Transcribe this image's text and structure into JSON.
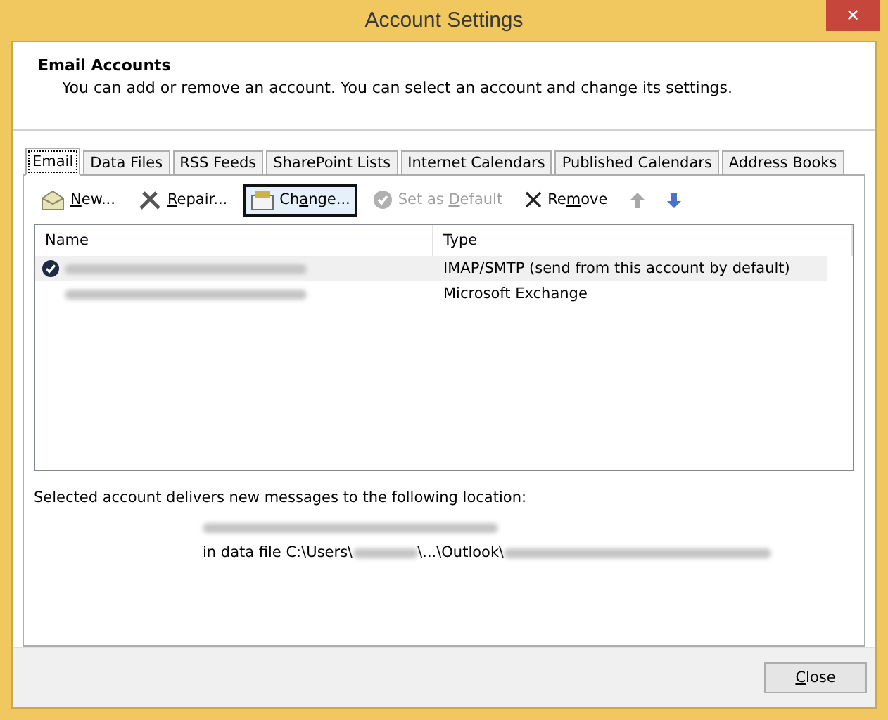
{
  "window": {
    "title": "Account Settings",
    "close": "✕"
  },
  "header": {
    "title": "Email Accounts",
    "description": "You can add or remove an account. You can select an account and change its settings."
  },
  "tabs": [
    {
      "label": "Email",
      "selected": true
    },
    {
      "label": "Data Files",
      "selected": false
    },
    {
      "label": "RSS Feeds",
      "selected": false
    },
    {
      "label": "SharePoint Lists",
      "selected": false
    },
    {
      "label": "Internet Calendars",
      "selected": false
    },
    {
      "label": "Published Calendars",
      "selected": false
    },
    {
      "label": "Address Books",
      "selected": false
    }
  ],
  "toolbar": [
    {
      "kind": "new",
      "key": "N",
      "after": "ew...",
      "disabled": false,
      "focused": false
    },
    {
      "kind": "repair",
      "key": "R",
      "after": "epair...",
      "disabled": false,
      "focused": false
    },
    {
      "kind": "change",
      "before": "Ch",
      "key": "a",
      "after": "nge...",
      "disabled": false,
      "focused": true
    },
    {
      "kind": "default",
      "before": "Set as ",
      "key": "D",
      "after": "efault",
      "disabled": true,
      "focused": false
    },
    {
      "kind": "remove",
      "before": "Re",
      "key": "m",
      "after": "ove",
      "disabled": false,
      "focused": false
    },
    {
      "kind": "up",
      "disabled": true,
      "focused": false
    },
    {
      "kind": "down",
      "disabled": false,
      "focused": false
    }
  ],
  "table": {
    "columns": [
      "Name",
      "Type"
    ],
    "rows": [
      {
        "default": true,
        "selected": true,
        "type": "IMAP/SMTP (send from this account by default)"
      },
      {
        "default": false,
        "selected": false,
        "type": "Microsoft Exchange"
      }
    ]
  },
  "location": {
    "label": "Selected account delivers new messages to the following location:",
    "path_prefix": "in data file C:\\Users\\",
    "path_middle": "\\...\\Outlook\\"
  },
  "buttons": [
    {
      "key": "C",
      "after": "lose"
    }
  ]
}
